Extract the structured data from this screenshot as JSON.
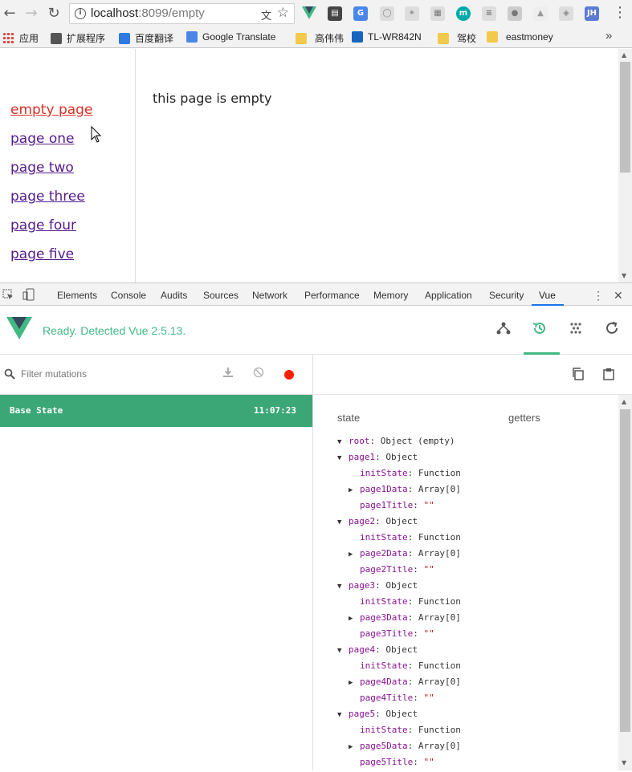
{
  "browser": {
    "url_host": "localhost",
    "url_rest": ":8099/empty",
    "extension_jh_label": "JH",
    "extension_m_label": "m"
  },
  "bookmarks": [
    {
      "label": "应用"
    },
    {
      "label": "扩展程序"
    },
    {
      "label": "百度翻译"
    },
    {
      "label": "Google Translate"
    },
    {
      "label": "高伟伟"
    },
    {
      "label": "TL-WR842N"
    },
    {
      "label": "驾校"
    },
    {
      "label": "eastmoney"
    }
  ],
  "page": {
    "nav": [
      {
        "label": "empty page",
        "active": true
      },
      {
        "label": "page one"
      },
      {
        "label": "page two"
      },
      {
        "label": "page three"
      },
      {
        "label": "page four"
      },
      {
        "label": "page five"
      }
    ],
    "content_text": "this page is empty"
  },
  "devtools": {
    "tabs": [
      "Elements",
      "Console",
      "Audits",
      "Sources",
      "Network",
      "Performance",
      "Memory",
      "Application",
      "Security",
      "Vue"
    ],
    "active_tab": "Vue"
  },
  "vue": {
    "status": "Ready. Detected Vue 2.5.13.",
    "brand_color": "#42b983",
    "filter_placeholder": "Filter mutations",
    "base_state_label": "Base State",
    "base_state_time": "11:07:23",
    "state_header": "state",
    "getters_header": "getters",
    "tree": [
      {
        "indent": 0,
        "open": true,
        "key": "root",
        "value": "Object (empty)",
        "kind": "obj"
      },
      {
        "indent": 0,
        "open": true,
        "key": "page1",
        "value": "Object",
        "kind": "obj"
      },
      {
        "indent": 1,
        "key": "initState",
        "value": "Function",
        "kind": "plain"
      },
      {
        "indent": 1,
        "open": false,
        "key": "page1Data",
        "value": "Array[0]",
        "kind": "arr"
      },
      {
        "indent": 1,
        "key": "page1Title",
        "value": "\"\"",
        "kind": "str"
      },
      {
        "indent": 0,
        "open": true,
        "key": "page2",
        "value": "Object",
        "kind": "obj"
      },
      {
        "indent": 1,
        "key": "initState",
        "value": "Function",
        "kind": "plain"
      },
      {
        "indent": 1,
        "open": false,
        "key": "page2Data",
        "value": "Array[0]",
        "kind": "arr"
      },
      {
        "indent": 1,
        "key": "page2Title",
        "value": "\"\"",
        "kind": "str"
      },
      {
        "indent": 0,
        "open": true,
        "key": "page3",
        "value": "Object",
        "kind": "obj"
      },
      {
        "indent": 1,
        "key": "initState",
        "value": "Function",
        "kind": "plain"
      },
      {
        "indent": 1,
        "open": false,
        "key": "page3Data",
        "value": "Array[0]",
        "kind": "arr"
      },
      {
        "indent": 1,
        "key": "page3Title",
        "value": "\"\"",
        "kind": "str"
      },
      {
        "indent": 0,
        "open": true,
        "key": "page4",
        "value": "Object",
        "kind": "obj"
      },
      {
        "indent": 1,
        "key": "initState",
        "value": "Function",
        "kind": "plain"
      },
      {
        "indent": 1,
        "open": false,
        "key": "page4Data",
        "value": "Array[0]",
        "kind": "arr"
      },
      {
        "indent": 1,
        "key": "page4Title",
        "value": "\"\"",
        "kind": "str"
      },
      {
        "indent": 0,
        "open": true,
        "key": "page5",
        "value": "Object",
        "kind": "obj"
      },
      {
        "indent": 1,
        "key": "initState",
        "value": "Function",
        "kind": "plain"
      },
      {
        "indent": 1,
        "open": false,
        "key": "page5Data",
        "value": "Array[0]",
        "kind": "arr"
      },
      {
        "indent": 1,
        "key": "page5Title",
        "value": "\"\"",
        "kind": "str"
      }
    ]
  }
}
